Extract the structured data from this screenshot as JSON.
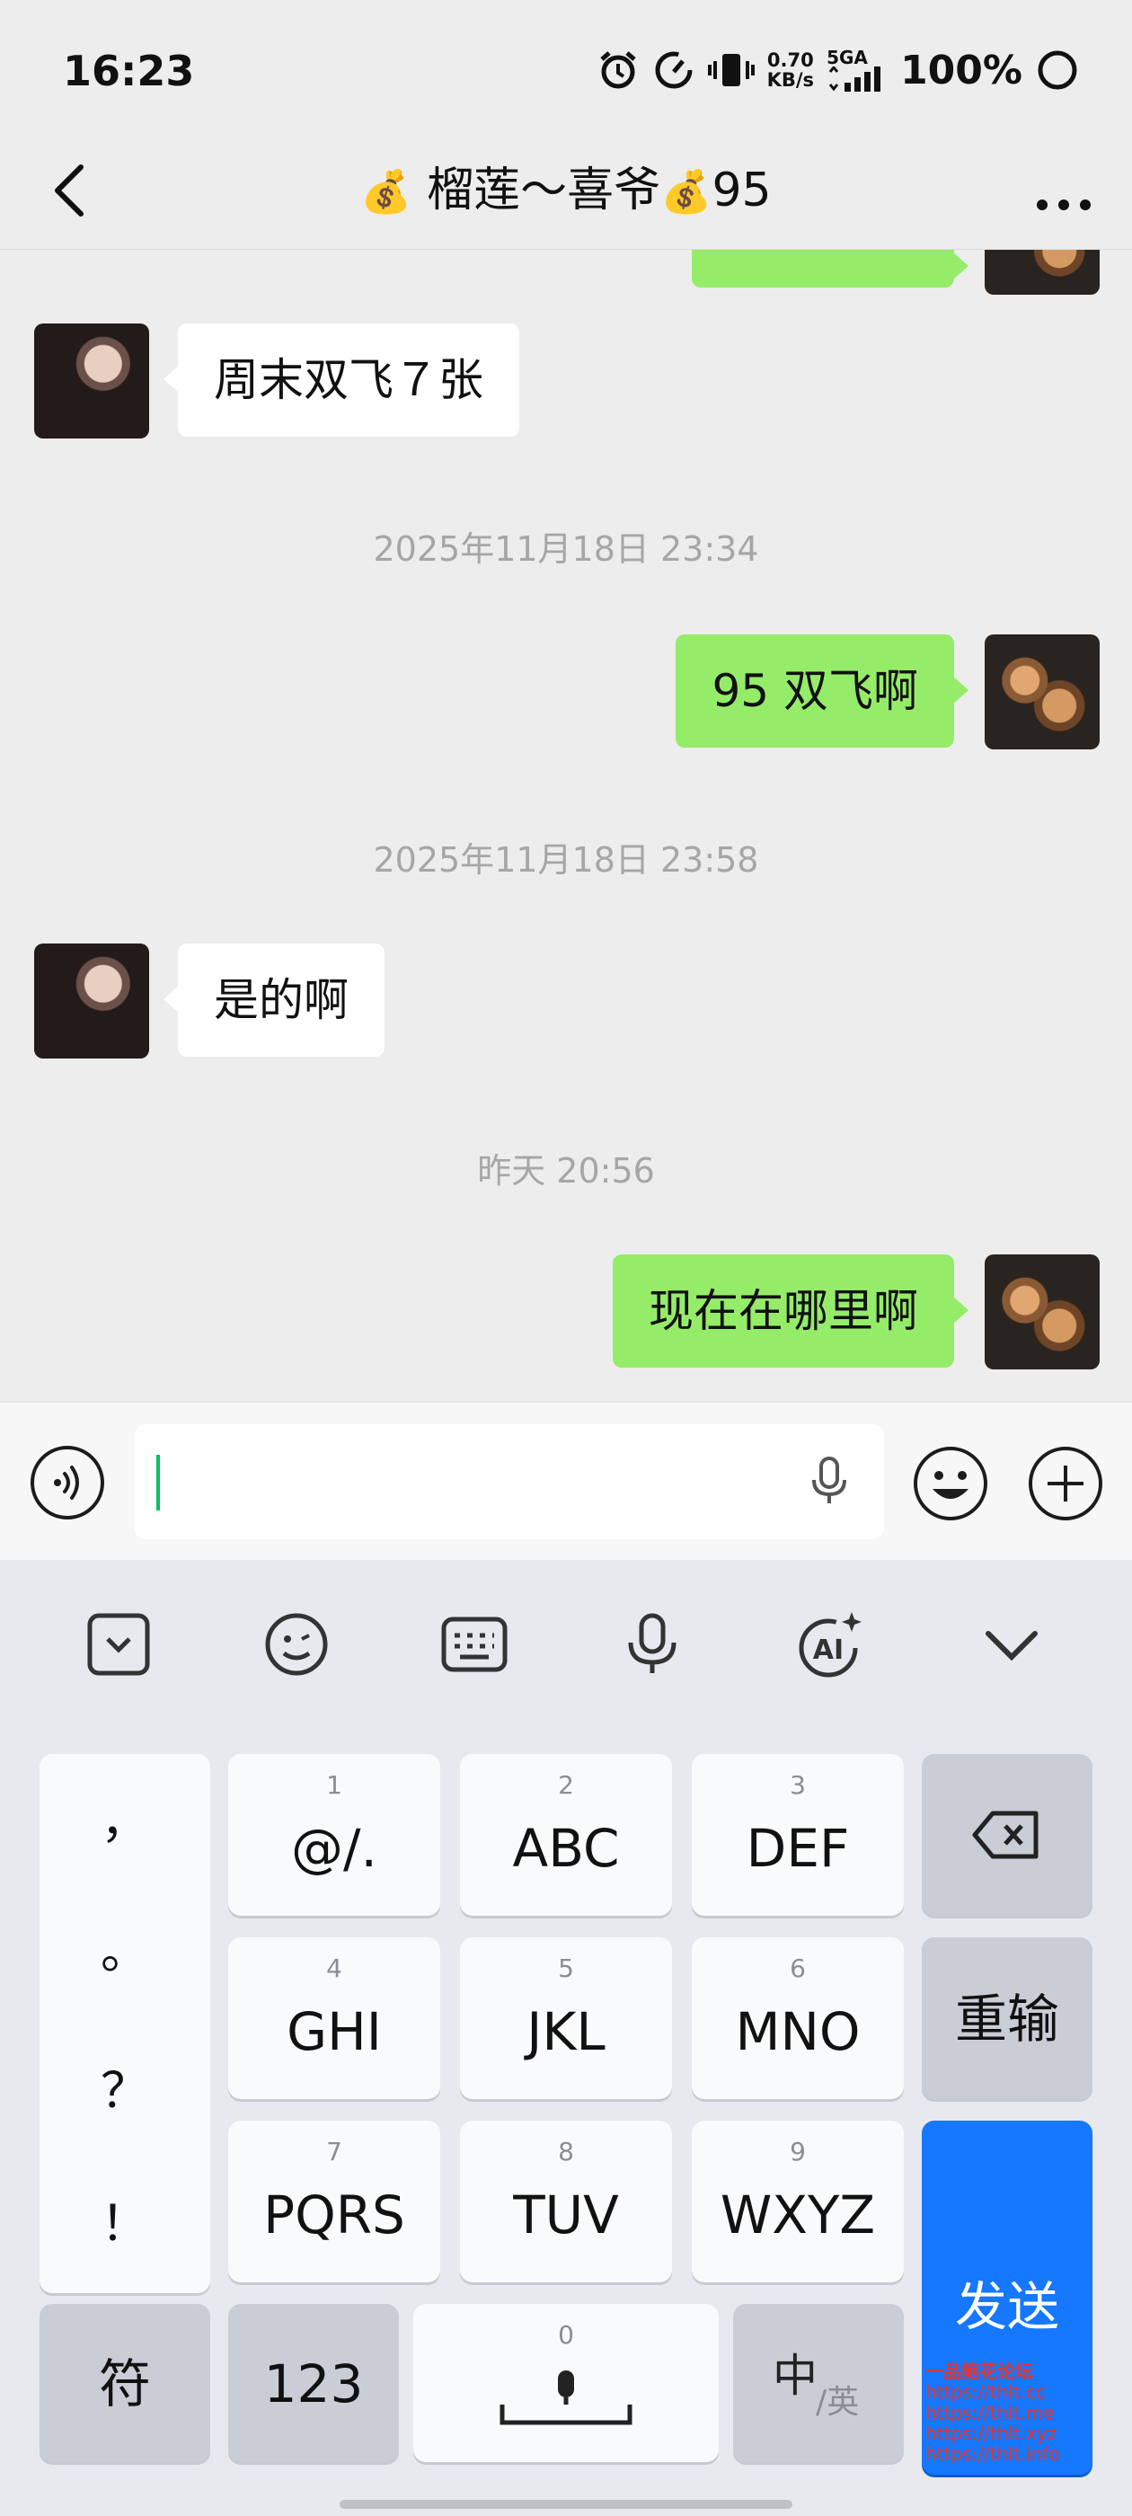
{
  "status_bar": {
    "time": "16:23",
    "net_speed_value": "0.70",
    "net_speed_unit": "KB/s",
    "network_type": "5GA",
    "battery": "100%"
  },
  "header": {
    "title_prefix_emoji": "💰",
    "title_text": " 榴莲～喜爷",
    "title_mid_emoji": "💰",
    "title_suffix": "95",
    "back_icon": "chevron-left-icon",
    "more_icon": "more-dots-icon"
  },
  "messages": [
    {
      "side": "right",
      "text": "…",
      "avatar": "dog"
    },
    {
      "side": "left",
      "text": "周末双飞７张",
      "avatar": "girl"
    },
    {
      "type": "timestamp",
      "text": "2025年11月18日 23:34"
    },
    {
      "side": "right",
      "text": "95 双飞啊",
      "avatar": "dog"
    },
    {
      "type": "timestamp",
      "text": "2025年11月18日 23:58"
    },
    {
      "side": "left",
      "text": "是的啊",
      "avatar": "girl"
    },
    {
      "type": "timestamp",
      "text": "昨天 20:56"
    },
    {
      "side": "right",
      "text": "现在在哪里啊",
      "avatar": "dog"
    }
  ],
  "input_bar": {
    "value": "",
    "icons": [
      "voice-icon",
      "mic-icon",
      "emoji-icon",
      "plus-icon"
    ]
  },
  "keyboard": {
    "toolbar_icons": [
      "collapse-box-icon",
      "emoji-face-icon",
      "keyboard-icon",
      "mic-icon",
      "ai-icon",
      "chevron-down-icon"
    ],
    "punctuation": [
      "，",
      "。",
      "？",
      "！"
    ],
    "keys": [
      {
        "num": "1",
        "label": "@/."
      },
      {
        "num": "2",
        "label": "ABC"
      },
      {
        "num": "3",
        "label": "DEF"
      },
      {
        "num": "4",
        "label": "GHI"
      },
      {
        "num": "5",
        "label": "JKL"
      },
      {
        "num": "6",
        "label": "MNO"
      },
      {
        "num": "7",
        "label": "PQRS"
      },
      {
        "num": "8",
        "label": "TUV"
      },
      {
        "num": "9",
        "label": "WXYZ"
      }
    ],
    "reenter": "重输",
    "send": "发送",
    "symbols": "符",
    "numbers": "123",
    "space_num": "0",
    "lang_main": "中",
    "lang_sub": "/英",
    "colors": {
      "send": "#1677ff",
      "caret": "#07c160",
      "bubble_right": "#95ec69"
    }
  },
  "watermark": {
    "line1": "一品鲍花论坛",
    "line2": "https://thlt.cc",
    "line3": "https://thlt.me",
    "line4": "https://thlt.xyz",
    "line5": "https://thlt.info"
  }
}
